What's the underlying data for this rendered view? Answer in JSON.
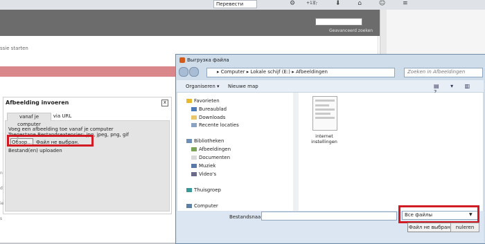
{
  "browser": {
    "translate_label": "Перевести",
    "addon_count": "+13"
  },
  "page": {
    "advanced_search": "Geavanceerd zoeken",
    "partial_text": "ssie starten"
  },
  "dialog": {
    "title": "Afbeelding invoeren",
    "close": "x",
    "tabs": [
      "vanaf je computer",
      "via URL"
    ],
    "line1": "Voeg een afbeelding toe vanaf je computer",
    "line2": "Toegestane Bestandsextensies: jpg, jpeg, png, gif",
    "browse_button": "Обзор...",
    "no_file": "Файл не выбран.",
    "upload": "Bestand(en) uploaden"
  },
  "file_dialog": {
    "title": "Выгрузка файла",
    "address": "▸  Computer  ▸  Lokale schijf (E:)  ▸  Afbeeldingen",
    "search_placeholder": "Zoeken in Afbeeldingen",
    "organize": "Organiseren ▾",
    "new_folder": "Nieuwe map",
    "nav": {
      "favorites": "Favorieten",
      "desktop": "Bureaublad",
      "downloads": "Downloads",
      "recent": "Recente locaties",
      "libraries": "Bibliotheken",
      "pictures": "Afbeeldingen",
      "documents": "Documenten",
      "music": "Muziek",
      "videos": "Video's",
      "homegroup": "Thuisgroep",
      "computer": "Computer"
    },
    "file": {
      "name": "internet instellingen"
    },
    "filename_label": "Bestandsnaam:",
    "filename_value": "",
    "filetype": "Все файлы",
    "open_button": "Файл не выбран.",
    "cancel_button": "nuleren"
  },
  "colors": {
    "highlight": "#d11a24",
    "red_bar": "#d9878a",
    "dialog_frame": "#cfdcea"
  }
}
